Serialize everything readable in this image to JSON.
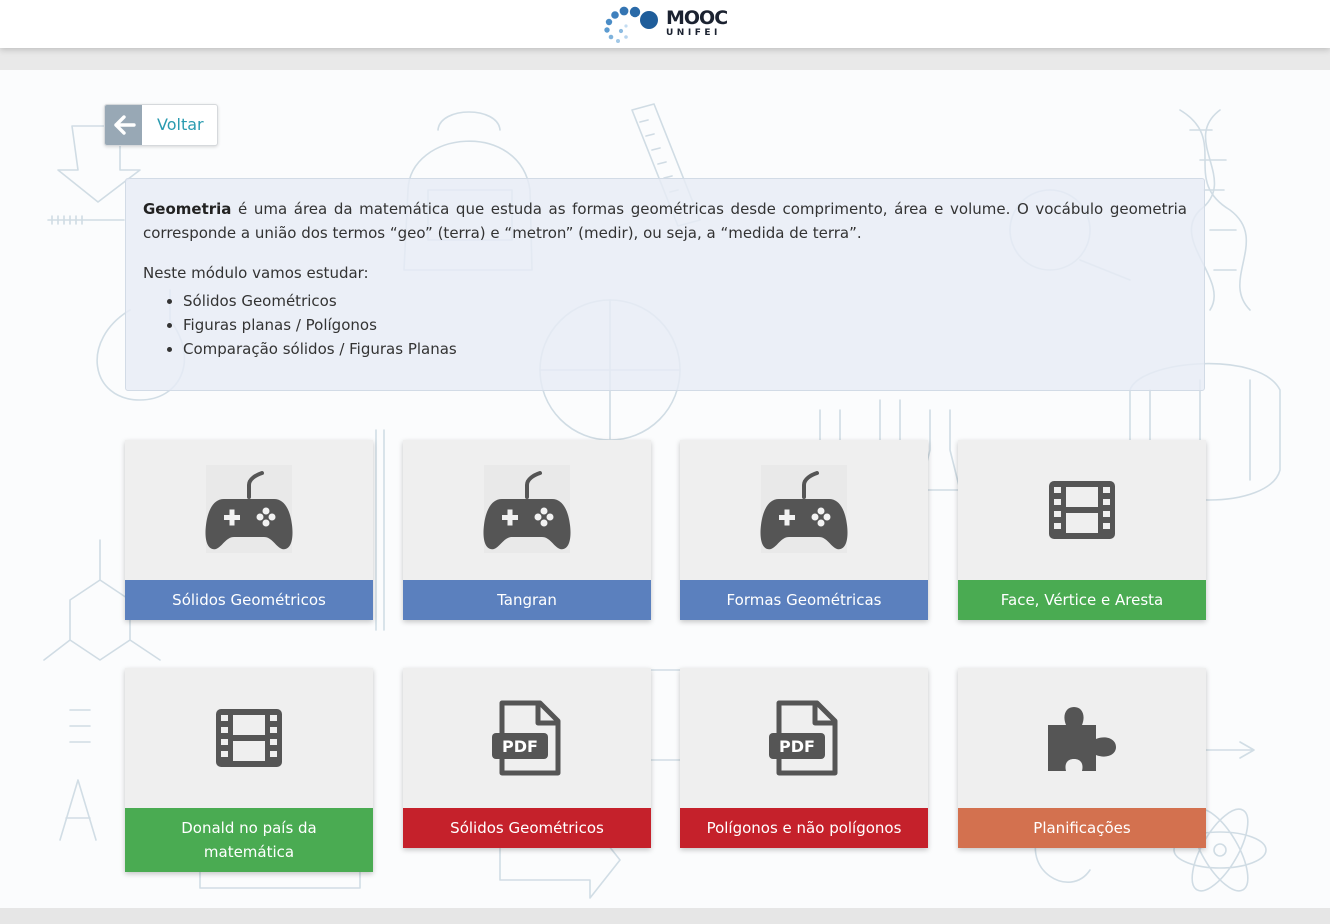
{
  "brand": {
    "line1": "MOOC",
    "line2": "UNIFEI"
  },
  "back_button": {
    "label": "Voltar"
  },
  "intro": {
    "lead": "Geometria",
    "paragraph": " é uma área da matemática que estuda as formas geométricas desde comprimento, área e volume. O vocábulo geometria corresponde a união dos termos “geo” (terra) e “metron” (medir), ou seja, a “medida de terra”.",
    "modules_heading": "Neste módulo vamos estudar:",
    "topics": [
      "Sólidos Geométricos",
      "Figuras planas / Polígonos",
      "Comparação sólidos / Figuras Planas"
    ]
  },
  "cards": [
    {
      "label": "Sólidos Geométricos",
      "icon": "gamepad-icon",
      "color": "#5b80be"
    },
    {
      "label": "Tangran",
      "icon": "gamepad-icon",
      "color": "#5b80be"
    },
    {
      "label": "Formas Geométricas",
      "icon": "gamepad-icon",
      "color": "#5b80be"
    },
    {
      "label": "Face, Vértice e Aresta",
      "icon": "film-icon",
      "color": "#4aab52"
    },
    {
      "label": "Donald no país da matemática",
      "icon": "film-icon",
      "color": "#4aab52"
    },
    {
      "label": "Sólidos Geométricos",
      "icon": "pdf-file-icon",
      "icon_text": "PDF",
      "color": "#c5212b"
    },
    {
      "label": "Polígonos e não polígonos",
      "icon": "pdf-file-icon",
      "icon_text": "PDF",
      "color": "#c5212b"
    },
    {
      "label": "Planificações",
      "icon": "puzzle-icon",
      "color": "#d3714f"
    }
  ]
}
